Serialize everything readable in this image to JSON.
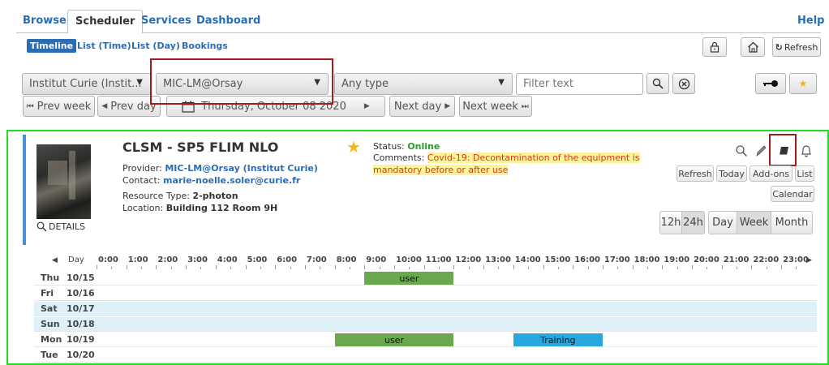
{
  "tabs": [
    "Browse",
    "Scheduler",
    "Services",
    "Dashboard"
  ],
  "help_label": "Help",
  "subtabs": [
    "Timeline",
    "List (Time)",
    "List (Day)",
    "Bookings"
  ],
  "refresh_label": "Refresh",
  "filters": {
    "institute": "Institut Curie (Instit...",
    "facility": "MIC-LM@Orsay",
    "type": "Any type",
    "text_placeholder": "Filter text"
  },
  "nav": {
    "prev_week": "Prev week",
    "prev_day": "Prev day",
    "date": "Thursday, October 08 2020",
    "next_day": "Next day",
    "next_week": "Next week"
  },
  "resource": {
    "title": "CLSM - SP5 FLIM NLO",
    "details_label": "DETAILS",
    "provider_label": "Provider:",
    "provider": "MIC-LM@Orsay (Institut Curie)",
    "contact_label": "Contact:",
    "contact": "marie-noelle.soler@curie.fr",
    "type_label": "Resource Type:",
    "type": "2-photon",
    "location_label": "Location:",
    "location": "Building 112 Room 9H",
    "status_label": "Status:",
    "status": "Online",
    "comments_label": "Comments:",
    "comments_line1": "Covid-19: Decontamination of the equipment is",
    "comments_line2": "mandatory before or after use"
  },
  "actions": {
    "refresh": "Refresh",
    "today": "Today",
    "addons": "Add-ons",
    "list": "List",
    "calendar": "Calendar"
  },
  "views": {
    "h12": "12h",
    "h24": "24h",
    "day": "Day",
    "week": "Week",
    "month": "Month"
  },
  "timeline": {
    "day_label": "Day",
    "hours": [
      "0:00",
      "1:00",
      "2:00",
      "3:00",
      "4:00",
      "5:00",
      "6:00",
      "7:00",
      "8:00",
      "9:00",
      "10:00",
      "11:00",
      "12:00",
      "13:00",
      "14:00",
      "15:00",
      "16:00",
      "17:00",
      "18:00",
      "19:00",
      "20:00",
      "21:00",
      "22:00",
      "23:00"
    ],
    "rows": [
      {
        "day": "Thu",
        "date": "10/15",
        "bookings": [
          {
            "label": "user",
            "start": 9,
            "end": 12,
            "color": "#6aa84f"
          }
        ]
      },
      {
        "day": "Fri",
        "date": "10/16",
        "bookings": []
      },
      {
        "day": "Sat",
        "date": "10/17",
        "bookings": []
      },
      {
        "day": "Sun",
        "date": "10/18",
        "bookings": []
      },
      {
        "day": "Mon",
        "date": "10/19",
        "bookings": [
          {
            "label": "user",
            "start": 8,
            "end": 12,
            "color": "#6aa84f"
          },
          {
            "label": "Training",
            "start": 14,
            "end": 17,
            "color": "#29a8e0"
          }
        ]
      },
      {
        "day": "Tue",
        "date": "10/20",
        "bookings": []
      }
    ]
  }
}
